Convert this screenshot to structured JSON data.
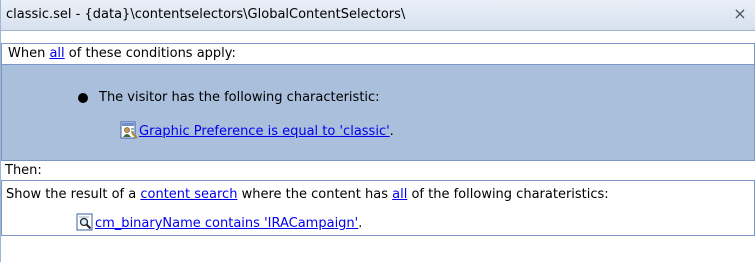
{
  "window": {
    "title": "classic.sel - {data}\\contentselectors\\GlobalContentSelectors\\",
    "close_glyph": "×"
  },
  "condition": {
    "prefix": "When ",
    "quantifier_link": "all",
    "suffix": " of these conditions apply:",
    "characteristic_text": "The visitor has the following characteristic:",
    "rule_icon": "user-profile-icon",
    "rule_link": "Graphic Preference is equal to 'classic'",
    "rule_period": "."
  },
  "then": {
    "label": "Then:"
  },
  "action": {
    "part1": "Show the result of a ",
    "content_search_link": "content search",
    "part2": " where the content has ",
    "quantifier_link": "all",
    "part3": " of the following charateristics:",
    "search_icon": "magnifier-document-icon",
    "search_link": "cm_binaryName contains 'IRACampaign'",
    "search_period": "."
  },
  "colors": {
    "condition_band": "#a9bfdc",
    "border": "#7b98c4",
    "link": "#0000ee"
  }
}
